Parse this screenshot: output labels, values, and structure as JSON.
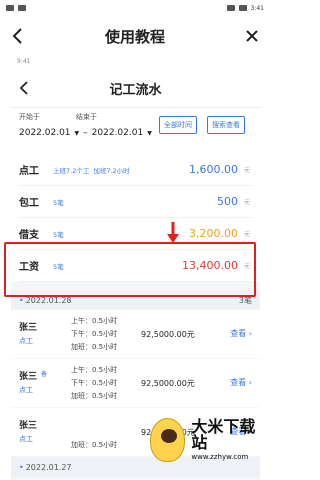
{
  "statusbar": {
    "left": "",
    "right": "3:41"
  },
  "app": {
    "title": "使用教程"
  },
  "phone": {
    "time": "9:41",
    "title": "记工流水",
    "filters": {
      "start_label": "开始于",
      "end_label": "结束于",
      "start_date": "2022.02.01",
      "end_date": "2022.02.01",
      "dash": "–",
      "btn_all": "全部时间",
      "btn_search": "搜索查看"
    },
    "summary": [
      {
        "name": "点工",
        "note1": "上班7.2个工",
        "note2": "加班7.2小时",
        "amount": "1,600.00",
        "unit": "元",
        "color": "#3b78e7"
      },
      {
        "name": "包工",
        "note1": "5笔",
        "note2": "",
        "amount": "500",
        "unit": "元",
        "color": "#3b78e7"
      },
      {
        "name": "借支",
        "note1": "5笔",
        "note2": "",
        "amount": "3,200.00",
        "unit": "元",
        "color": "#f0a020"
      },
      {
        "name": "工资",
        "note1": "5笔",
        "note2": "",
        "amount": "13,400.00",
        "unit": "元",
        "color": "#e03a3a"
      }
    ],
    "group1": {
      "date": "2022.01.28",
      "count": "3笔"
    },
    "records": [
      {
        "person": "张三",
        "role": "点工",
        "tag": "",
        "line1": "上午：0.5小时",
        "line2": "下午：0.5小时",
        "line3": "加班：0.5小时",
        "amount": "92,5000.00元",
        "view": "查看"
      },
      {
        "person": "张三",
        "role": "点工",
        "tag": "备",
        "line1": "上午：0.5小时",
        "line2": "下午：0.5小时",
        "line3": "加班：0.5小时",
        "amount": "92,5000.00元",
        "view": "查看"
      },
      {
        "person": "张三",
        "role": "点工",
        "tag": "",
        "line1": "",
        "line2": "",
        "line3": "加班：0.5小时",
        "amount": "92,5000.00元",
        "view": "查看"
      }
    ],
    "group2": {
      "date": "2022.01.27"
    }
  },
  "watermark": {
    "title": "大米下载站",
    "url": "www.zzhyw.com"
  }
}
